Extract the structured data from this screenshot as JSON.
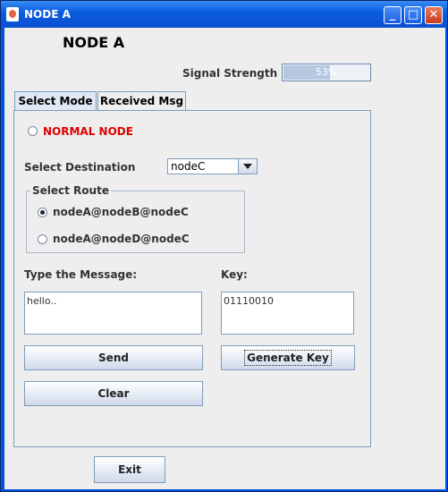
{
  "window": {
    "title": "NODE A"
  },
  "header": {
    "title": "NODE A"
  },
  "signal": {
    "label": "Signal Strength",
    "value_text": "53%",
    "value": 53
  },
  "tabs": [
    {
      "label": "Select Mode",
      "active": true
    },
    {
      "label": "Received Msg",
      "active": false
    }
  ],
  "mode": {
    "normal_node_label": "NORMAL NODE",
    "normal_node_color": "#dd0000"
  },
  "destination": {
    "label": "Select Destination",
    "selected": "nodeC"
  },
  "route": {
    "legend": "Select Route",
    "options": [
      {
        "label": "nodeA@nodeB@nodeC",
        "selected": true
      },
      {
        "label": "nodeA@nodeD@nodeC",
        "selected": false
      }
    ]
  },
  "message": {
    "label": "Type the Message:",
    "value": "hello.."
  },
  "key": {
    "label": "Key:",
    "value": "01110010"
  },
  "buttons": {
    "send": "Send",
    "generate_key": "Generate Key",
    "clear": "Clear",
    "exit": "Exit"
  }
}
